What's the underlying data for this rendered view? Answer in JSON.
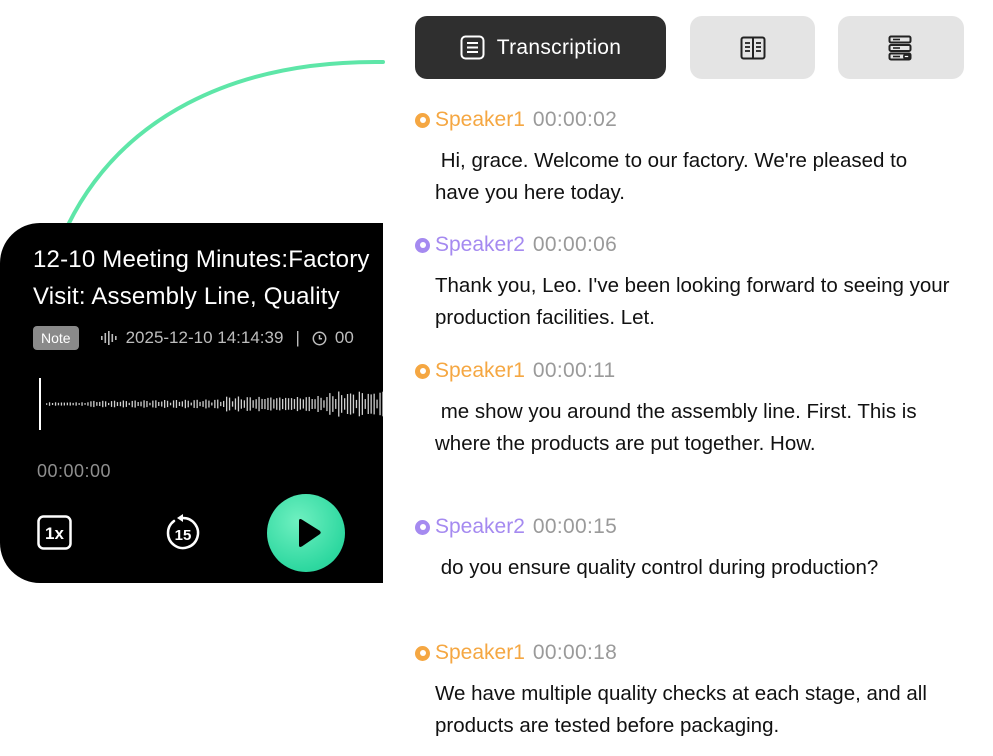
{
  "accent_colors": {
    "speaker1": "#f5a742",
    "speaker2": "#a58af0",
    "play": "#2ed8a0",
    "arc": "#5ee6a8"
  },
  "toolbar": {
    "transcription_label": "Transcription",
    "transcription_icon": "list-doc-icon",
    "summary_icon": "book-icon",
    "mindmap_icon": "outline-icon"
  },
  "player": {
    "title_line1": "12-10 Meeting Minutes:Factory",
    "title_line2": "Visit: Assembly Line, Quality",
    "badge": "Note",
    "waveform_icon": "waveform-icon",
    "datetime": "2025-12-10 14:14:39",
    "separator": "|",
    "duration_icon": "clock-icon",
    "duration": "00",
    "elapsed": "00:00:00",
    "speed_label": "1x",
    "rewind_label": "15",
    "play_icon": "play-icon"
  },
  "transcript": [
    {
      "speaker": "Speaker1",
      "time": "00:00:02",
      "text": " Hi, grace. Welcome to our factory. We're pleased to have you here today."
    },
    {
      "speaker": "Speaker2",
      "time": "00:00:06",
      "text": "Thank you, Leo. I've been looking forward to seeing your production facilities. Let."
    },
    {
      "speaker": "Speaker1",
      "time": "00:00:11",
      "text": " me show you around the assembly line. First. This is where the products are put together. How."
    },
    {
      "speaker": "Speaker2",
      "time": "00:00:15",
      "text": " do you ensure quality control during production?"
    },
    {
      "speaker": "Speaker1",
      "time": "00:00:18",
      "text": "We have multiple quality checks at each stage, and all products are tested before packaging."
    }
  ]
}
